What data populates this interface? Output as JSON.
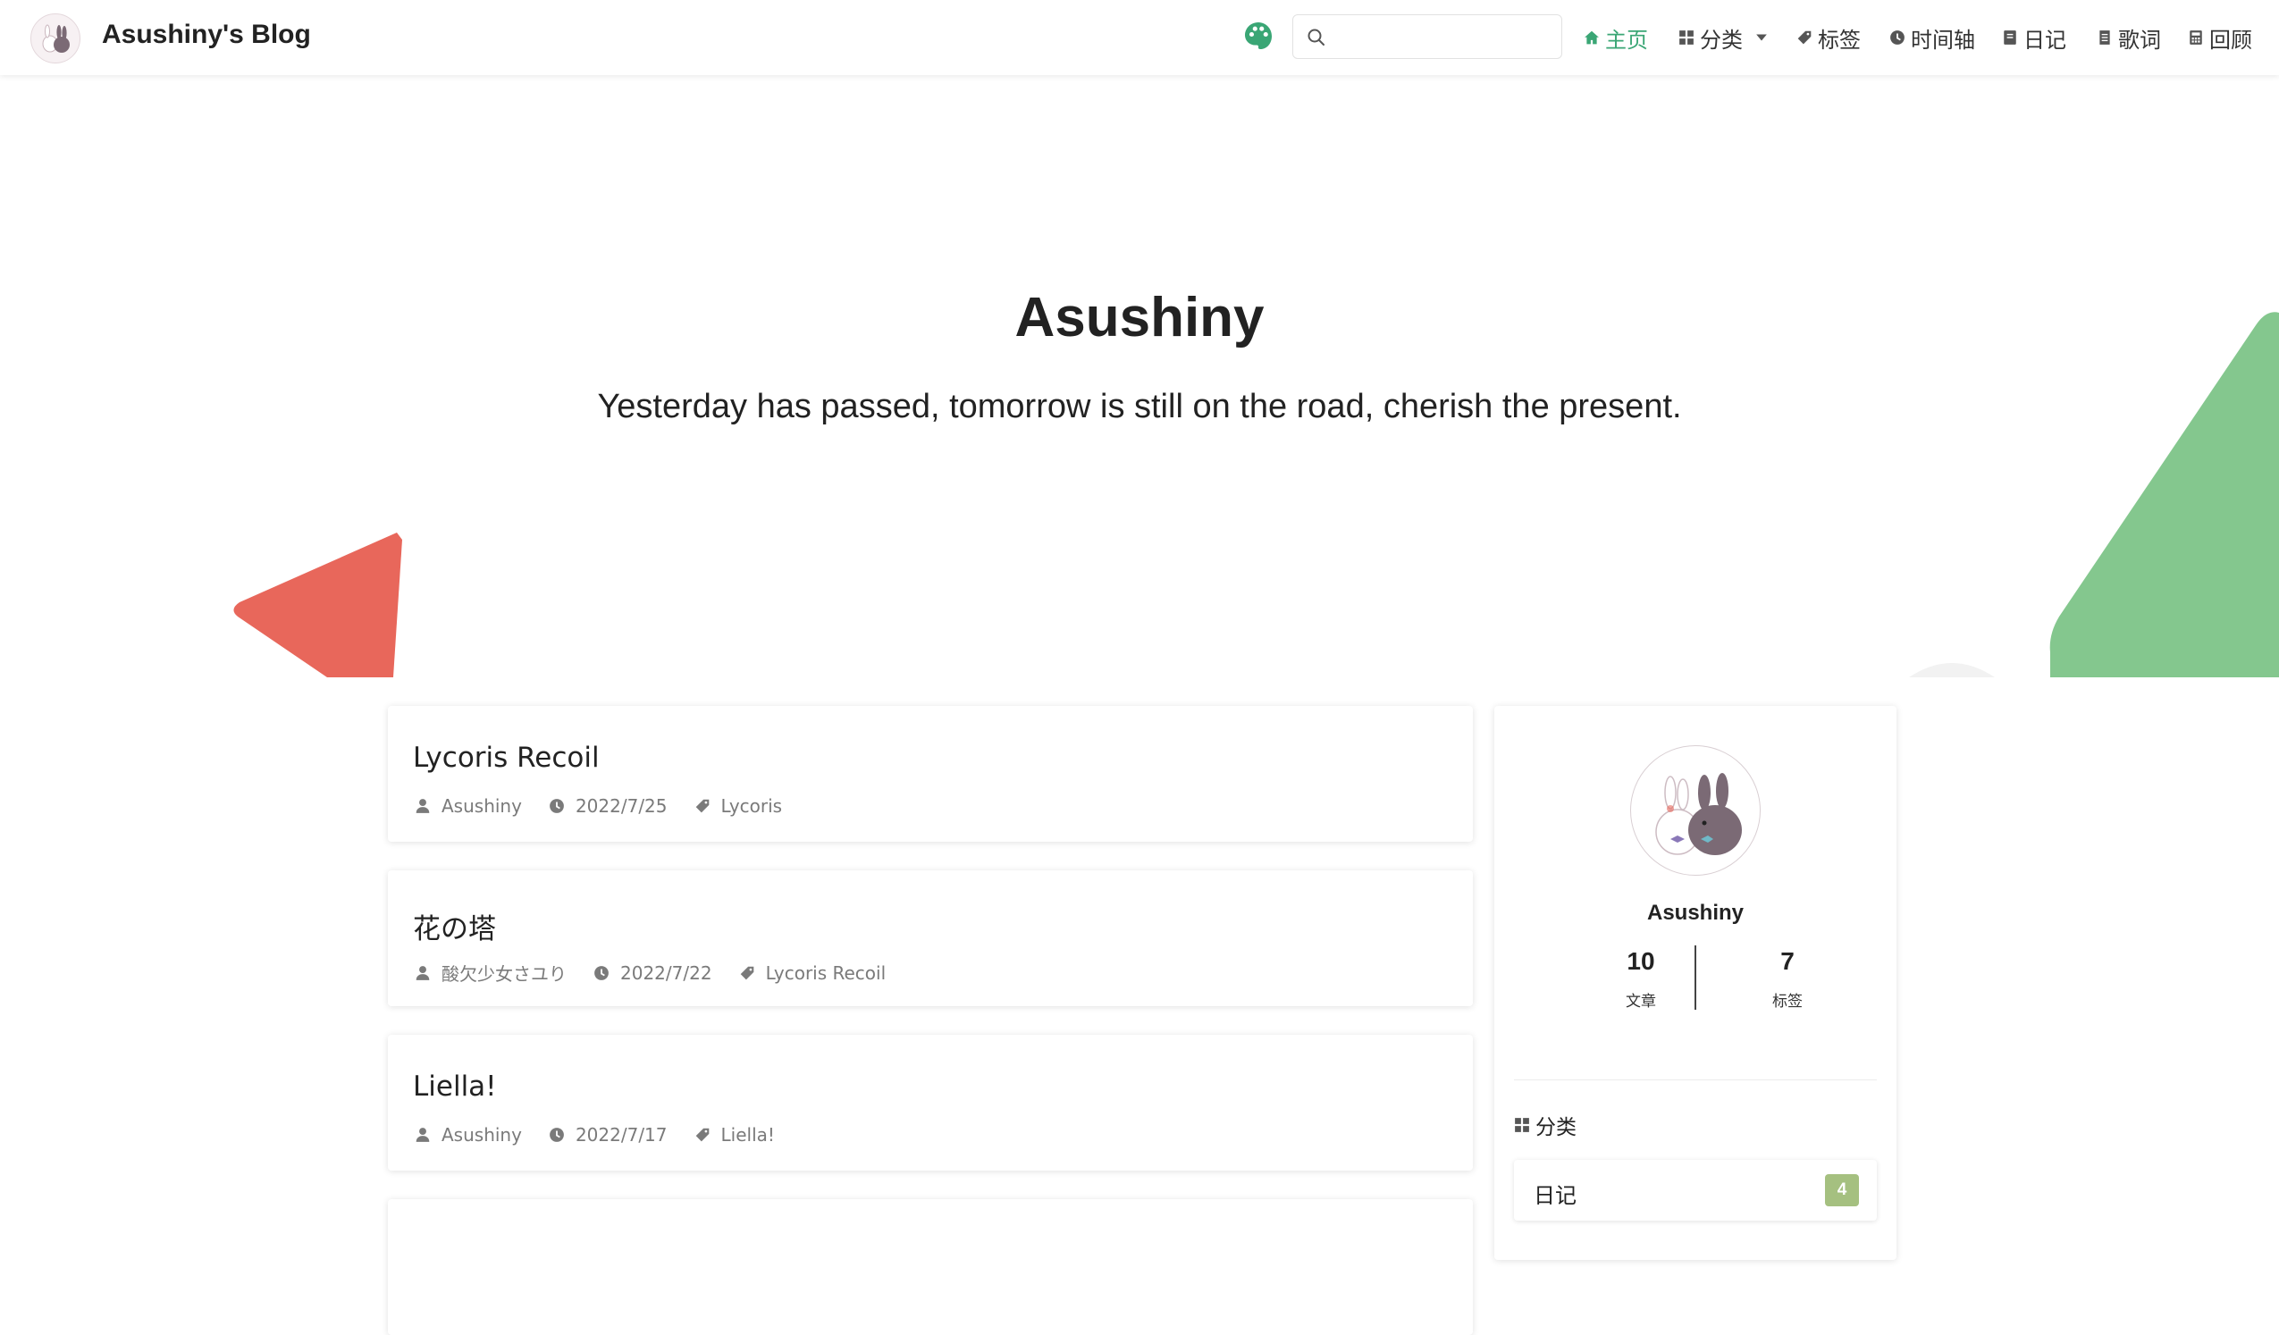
{
  "brand": {
    "name": "Asushiny's Blog"
  },
  "search": {
    "placeholder": "",
    "value": ""
  },
  "nav": {
    "items": [
      {
        "label": "主页",
        "icon": "home-icon",
        "active": true
      },
      {
        "label": "分类",
        "icon": "grid-icon",
        "dropdown": true
      },
      {
        "label": "标签",
        "icon": "tag-icon"
      },
      {
        "label": "时间轴",
        "icon": "clock-icon"
      },
      {
        "label": "日记",
        "icon": "notebook-icon"
      },
      {
        "label": "歌词",
        "icon": "document-icon"
      },
      {
        "label": "回顾",
        "icon": "calculator-icon"
      }
    ]
  },
  "hero": {
    "title": "Asushiny",
    "subtitle": "Yesterday has passed, tomorrow is still on the road, cherish the present."
  },
  "posts": [
    {
      "title": "Lycoris Recoil",
      "author": "Asushiny",
      "date": "2022/7/25",
      "tag": "Lycoris"
    },
    {
      "title": "花の塔",
      "author": "酸欠少女さユり",
      "date": "2022/7/22",
      "tag": "Lycoris Recoil"
    },
    {
      "title": "Liella!",
      "author": "Asushiny",
      "date": "2022/7/17",
      "tag": "Liella!"
    }
  ],
  "sidebar": {
    "name": "Asushiny",
    "stats": [
      {
        "value": "10",
        "label": "文章"
      },
      {
        "value": "7",
        "label": "标签"
      }
    ],
    "categories_heading": "分类",
    "categories": [
      {
        "name": "日记",
        "count": "4"
      }
    ]
  },
  "colors": {
    "accent": "#3aa675",
    "hero_red": "#e8675b",
    "hero_green": "#84c78e",
    "badge": "#a5c080"
  }
}
